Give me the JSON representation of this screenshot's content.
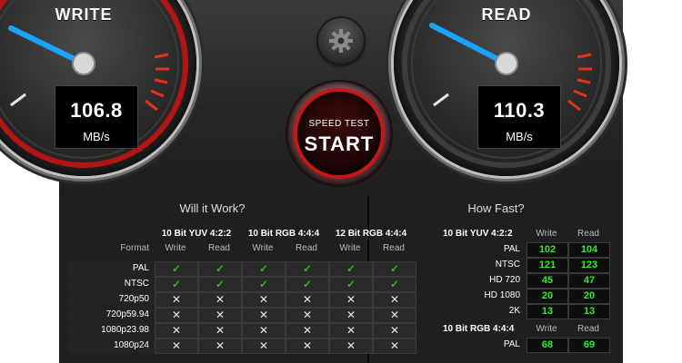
{
  "colors": {
    "accent_red": "#c41818",
    "needle_blue": "#1aa3ff",
    "ok_green": "#3fd23f"
  },
  "write_gauge": {
    "title": "WRITE",
    "value": "106.8",
    "unit": "MB/s",
    "needle_icon": "needle-icon"
  },
  "read_gauge": {
    "title": "READ",
    "value": "110.3",
    "unit": "MB/s",
    "needle_icon": "needle-icon"
  },
  "settings": {
    "icon": "gear-icon"
  },
  "start_button": {
    "caption": "SPEED TEST",
    "label": "START"
  },
  "will_it_work": {
    "title": "Will it Work?",
    "format_label": "Format",
    "columns": [
      {
        "name": "10 Bit YUV 4:2:2",
        "sub": [
          "Write",
          "Read"
        ]
      },
      {
        "name": "10 Bit RGB 4:4:4",
        "sub": [
          "Write",
          "Read"
        ]
      },
      {
        "name": "12 Bit RGB 4:4:4",
        "sub": [
          "Write",
          "Read"
        ]
      }
    ],
    "rows": [
      {
        "format": "PAL",
        "results": [
          "✓",
          "✓",
          "✓",
          "✓",
          "✓",
          "✓"
        ]
      },
      {
        "format": "NTSC",
        "results": [
          "✓",
          "✓",
          "✓",
          "✓",
          "✓",
          "✓"
        ]
      },
      {
        "format": "720p50",
        "results": [
          "✕",
          "✕",
          "✕",
          "✕",
          "✕",
          "✕"
        ]
      },
      {
        "format": "720p59.94",
        "results": [
          "✕",
          "✕",
          "✕",
          "✕",
          "✕",
          "✕"
        ]
      },
      {
        "format": "1080p23.98",
        "results": [
          "✕",
          "✕",
          "✕",
          "✕",
          "✕",
          "✕"
        ]
      },
      {
        "format": "1080p24",
        "results": [
          "✕",
          "✕",
          "✕",
          "✕",
          "✕",
          "✕"
        ]
      }
    ]
  },
  "how_fast": {
    "title": "How Fast?",
    "groups": [
      {
        "name": "10 Bit YUV 4:2:2",
        "sub": [
          "Write",
          "Read"
        ],
        "rows": [
          {
            "format": "PAL",
            "write": "102",
            "read": "104"
          },
          {
            "format": "NTSC",
            "write": "121",
            "read": "123"
          },
          {
            "format": "HD 720",
            "write": "45",
            "read": "47"
          },
          {
            "format": "HD 1080",
            "write": "20",
            "read": "20"
          },
          {
            "format": "2K",
            "write": "13",
            "read": "13"
          }
        ]
      },
      {
        "name": "10 Bit RGB 4:4:4",
        "sub": [
          "Write",
          "Read"
        ],
        "rows": [
          {
            "format": "PAL",
            "write": "68",
            "read": "69"
          }
        ]
      }
    ]
  }
}
